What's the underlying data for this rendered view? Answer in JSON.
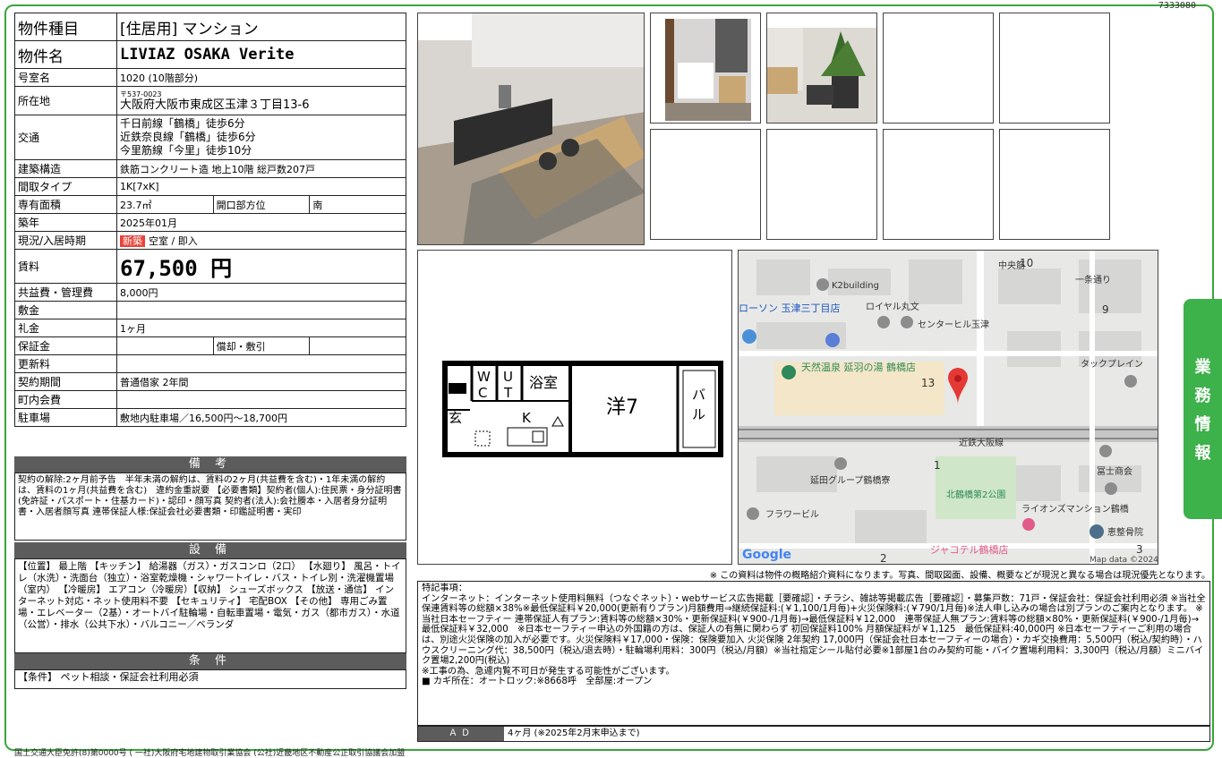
{
  "doc_number": "7333080",
  "property": {
    "type_label": "物件種目",
    "type_value": "[住居用] マンション",
    "name_label": "物件名",
    "name_value": "LIVIAZ OSAKA Verite",
    "room_label": "号室名",
    "room_value": "1020 (10階部分)",
    "location_label": "所在地",
    "zip": "〒537-0023",
    "address": "大阪府大阪市東成区玉津３丁目13-6",
    "traffic_label": "交通",
    "traffic": [
      "千日前線「鶴橋」徒歩6分",
      "近鉄奈良線「鶴橋」徒歩6分",
      "今里筋線「今里」徒歩10分"
    ],
    "structure_label": "建築構造",
    "structure_value": "鉄筋コンクリート造 地上10階 総戸数207戸",
    "layout_label": "間取タイプ",
    "layout_value": "1K[7xK]",
    "area_label": "専有面積",
    "area_value": "23.7㎡",
    "direction_label": "開口部方位",
    "direction_value": "南",
    "built_label": "築年",
    "built_value": "2025年01月",
    "status_label": "現況/入居時期",
    "status_badge": "新築",
    "status_value": "空室 / 即入",
    "rent_label": "賃料",
    "rent_value": "67,500 円",
    "fee_label": "共益費・管理費",
    "fee_value": "8,000円",
    "shikikin_label": "敷金",
    "shikikin_value": "",
    "reikin_label": "礼金",
    "reikin_value": "1ヶ月",
    "hoshokin_label": "保証金",
    "hoshokin_value": "",
    "shokyaku_label": "償却・敷引",
    "shokyaku_value": "",
    "renewal_label": "更新料",
    "renewal_value": "",
    "contract_label": "契約期間",
    "contract_value": "普通借家 2年間",
    "community_label": "町内会費",
    "community_value": "",
    "parking_label": "駐車場",
    "parking_value": "敷地内駐車場／16,500円〜18,700円"
  },
  "remarks": {
    "heading": "備 考",
    "text": "契約の解除:2ヶ月前予告　半年未満の解約は、賃料の2ヶ月(共益費を含む)・1年未満の解約は、賃料の1ヶ月(共益費を含む)　違約金重説要 【必要書類】契約者(個人):住民票・身分証明書(免許証・パスポート・住基カード)・認印・顔写真 契約者(法人):会社謄本・入居者身分証明書・入居者顔写真 連帯保証人様:保証会社必要書類・印鑑証明書・実印"
  },
  "equipment": {
    "heading": "設 備",
    "text": "【位置】 最上階 【キッチン】 給湯器（ガス）・ガスコンロ（2口） 【水廻り】 風呂・トイレ（水洗）・洗面台（独立）・浴室乾燥機・シャワートイレ・バス・トイレ別・洗濯機置場（室内） 【冷暖房】 エアコン（冷暖房）【収納】 シューズボックス 【放送・通信】 インターネット対応・ネット使用料不要 【セキュリティ】 宅配BOX 【その他】 専用ごみ置場・エレベーター（2基）・オートバイ駐輪場・自転車置場・電気・ガス（都市ガス）・水道（公営）・排水（公共下水）・バルコニー／ベランダ"
  },
  "conditions": {
    "heading": "条 件",
    "text": "【条件】 ペット相談・保証会社利用必須"
  },
  "floorplan": {
    "wc": "WC",
    "ut": "UT",
    "bath": "浴室",
    "entrance": "玄",
    "kitchen": "K",
    "room": "洋7",
    "balcony": "バル"
  },
  "map": {
    "labels": [
      "K2building",
      "ローソン 玉津三丁目店",
      "ロイヤル丸文",
      "センターヒル玉津",
      "天然温泉 延羽の湯 鶴橋店",
      "タックプレイン",
      "近鉄大阪線",
      "延田グループ鶴橋寮",
      "北鶴橋第2公園",
      "冨士商会",
      "フラワービル",
      "ライオンズマンション鶴橋",
      "恵整骨院",
      "ジャコテル鶴橋店",
      "中央筋",
      "一条通り"
    ],
    "numbers": [
      "10",
      "9",
      "13",
      "1",
      "2",
      "3"
    ],
    "google": "Google",
    "credit": "Map data ©2024"
  },
  "note": "※ この資料は物件の概略紹介資料になります。写真、間取図面、設備、概要などが現況と異なる場合は現況優先となります。",
  "special": {
    "heading": "特記事項：",
    "lines": [
      "インターネット：インターネット使用料無料（つなぐネット）・webサービス広告掲載［要確認］・チラシ、雑誌等掲載広告［要確認］・募集戸数：71戸・保証会社：保証会社利用必須 ※当社全保連賃料等の総額×38%※最低保証料￥20,000(更新有りプラン)月額費用⇒継続保証料:(￥1,100/1月毎)+火災保険料:(￥790/1月毎)※法人申し込みの場合は別プランのご案内となります。 ※当社日本セーフティー 連帯保証人有プラン:賃料等の総額×30%・更新保証料(￥900-/1月毎)→最低保証料￥12,000　連帯保証人無プラン:賃料等の総額×80%・更新保証料(￥900-/1月毎)→最低保証料￥32,000　※日本セーフティー申込の外国籍の方は、保証人の有無に関わらず 初回保証料100% 月額保証料が￥1,125　最低保証料:40,000円 ※日本セーフティーご利用の場合は、別途火災保険の加入が必要です。火災保険料￥17,000・保険：保険要加入 火災保険 2年契約 17,000円（保証会社日本セーフティーの場合）・カギ交換費用：5,500円（税込/契約時）・ハウスクリーニング代：38,500円（税込/退去時）・駐輪場利用料：300円（税込/月額）※当社指定シール貼付必要※1部屋1台のみ契約可能・バイク置場利用料：3,300円（税込/月額）ミニバイク置場2,200円(税込)",
      "※工事の為、急遽内覧不可日が発生する可能性がございます。",
      "■ カギ所在：オートロック:※8668呼　全部屋:オープン"
    ]
  },
  "ad": {
    "label": "ＡＤ",
    "value": "4ヶ月 (※2025年2月末申込まで)"
  },
  "footer": "国土交通大臣免許(8)第0000号 ( 一社)大阪府宅地建物取引業協会 (公社)近畿地区不動産公正取引協議会加盟",
  "sidetab": [
    "業",
    "務",
    "情",
    "報"
  ]
}
